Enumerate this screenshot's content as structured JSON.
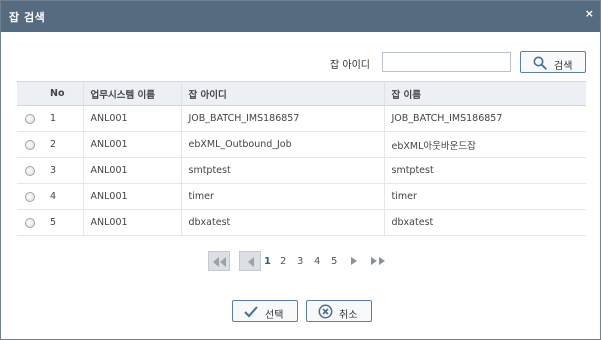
{
  "dialog": {
    "title": "잡 검색",
    "close_label": "×"
  },
  "search": {
    "label": "잡 아이디",
    "value": "",
    "placeholder": "",
    "button_label": "검색"
  },
  "table": {
    "headers": [
      "",
      "No",
      "업무시스템 이름",
      "잡 아이디",
      "잡 이름"
    ],
    "rows": [
      {
        "no": "1",
        "system": "ANL001",
        "job_id": "JOB_BATCH_IMS186857",
        "job_name": "JOB_BATCH_IMS186857"
      },
      {
        "no": "2",
        "system": "ANL001",
        "job_id": "ebXML_Outbound_Job",
        "job_name": "ebXML아웃바운드잡"
      },
      {
        "no": "3",
        "system": "ANL001",
        "job_id": "smtptest",
        "job_name": "smtptest"
      },
      {
        "no": "4",
        "system": "ANL001",
        "job_id": "timer",
        "job_name": "timer"
      },
      {
        "no": "5",
        "system": "ANL001",
        "job_id": "dbxatest",
        "job_name": "dbxatest"
      }
    ]
  },
  "pagination": {
    "pages": [
      "1",
      "2",
      "3",
      "4",
      "5"
    ],
    "current": "1"
  },
  "footer": {
    "select_label": "선택",
    "cancel_label": "취소"
  },
  "colors": {
    "titlebar": "#556b80",
    "accent": "#5b7fa6",
    "header_bg": "#ecf0f4"
  }
}
